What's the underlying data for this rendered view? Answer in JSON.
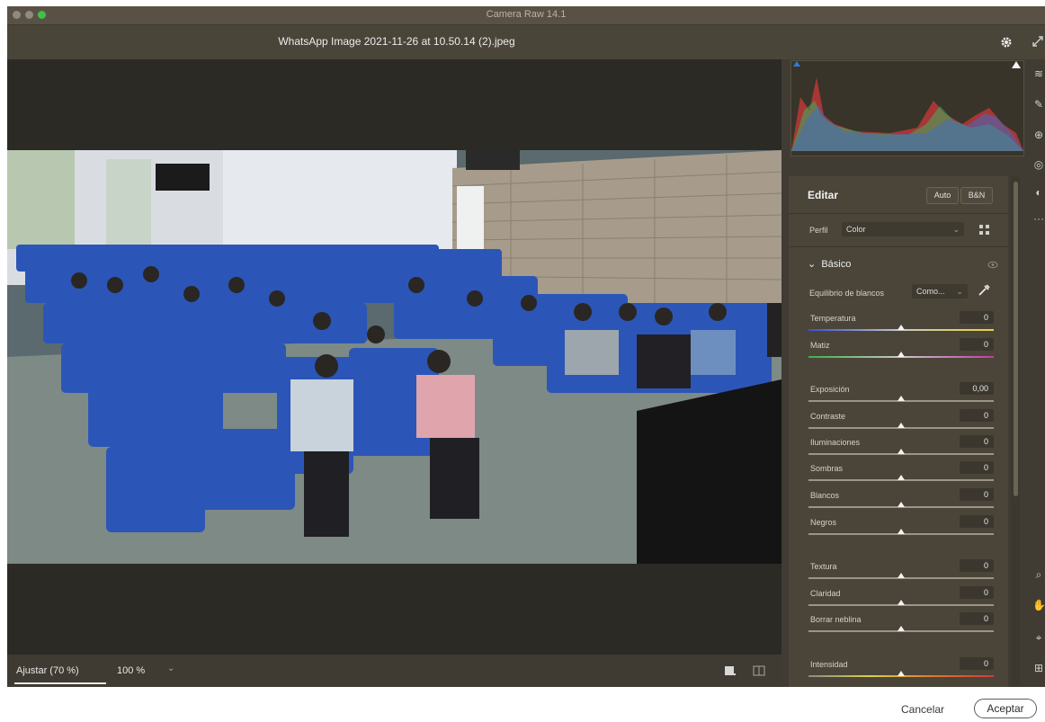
{
  "window": {
    "title": "Camera Raw 14.1",
    "filename": "WhatsApp Image 2021-11-26 at 10.50.14 (2).jpeg"
  },
  "toolbar_icons": [
    "gear-icon",
    "fullscreen-icon"
  ],
  "view": {
    "fit_label": "Ajustar (70 %)",
    "zoom_label": "100 %",
    "zoom_caret": "⌄"
  },
  "histogram": {
    "colors": {
      "red": "#d23a3a",
      "green": "#3fb25c",
      "blue": "#3a6ed2"
    }
  },
  "edit": {
    "title": "Editar",
    "auto_label": "Auto",
    "bw_label": "B&N",
    "profile_label": "Perfil",
    "profile_value": "Color",
    "section_label": "Básico",
    "wb_label": "Equilibrio de blancos",
    "wb_value": "Como..."
  },
  "sliders": [
    {
      "label": "Temperatura",
      "value": "0",
      "position": 0.5
    },
    {
      "label": "Matiz",
      "value": "0",
      "position": 0.5
    },
    {
      "label": "Exposición",
      "value": "0,00",
      "position": 0.5
    },
    {
      "label": "Contraste",
      "value": "0",
      "position": 0.5
    },
    {
      "label": "Iluminaciones",
      "value": "0",
      "position": 0.5
    },
    {
      "label": "Sombras",
      "value": "0",
      "position": 0.5
    },
    {
      "label": "Blancos",
      "value": "0",
      "position": 0.5
    },
    {
      "label": "Negros",
      "value": "0",
      "position": 0.5
    },
    {
      "label": "Textura",
      "value": "0",
      "position": 0.5
    },
    {
      "label": "Claridad",
      "value": "0",
      "position": 0.5
    },
    {
      "label": "Borrar neblina",
      "value": "0",
      "position": 0.5
    },
    {
      "label": "Intensidad",
      "value": "0",
      "position": 0.5
    }
  ],
  "actions": {
    "cancel_label": "Cancelar",
    "accept_label": "Aceptar"
  },
  "tools": [
    "edit-sliders-icon",
    "brush-icon",
    "heal-icon",
    "redeye-icon",
    "mask-icon",
    "more-icon",
    "zoom-icon",
    "hand-icon",
    "sampler-icon",
    "grid-icon"
  ]
}
